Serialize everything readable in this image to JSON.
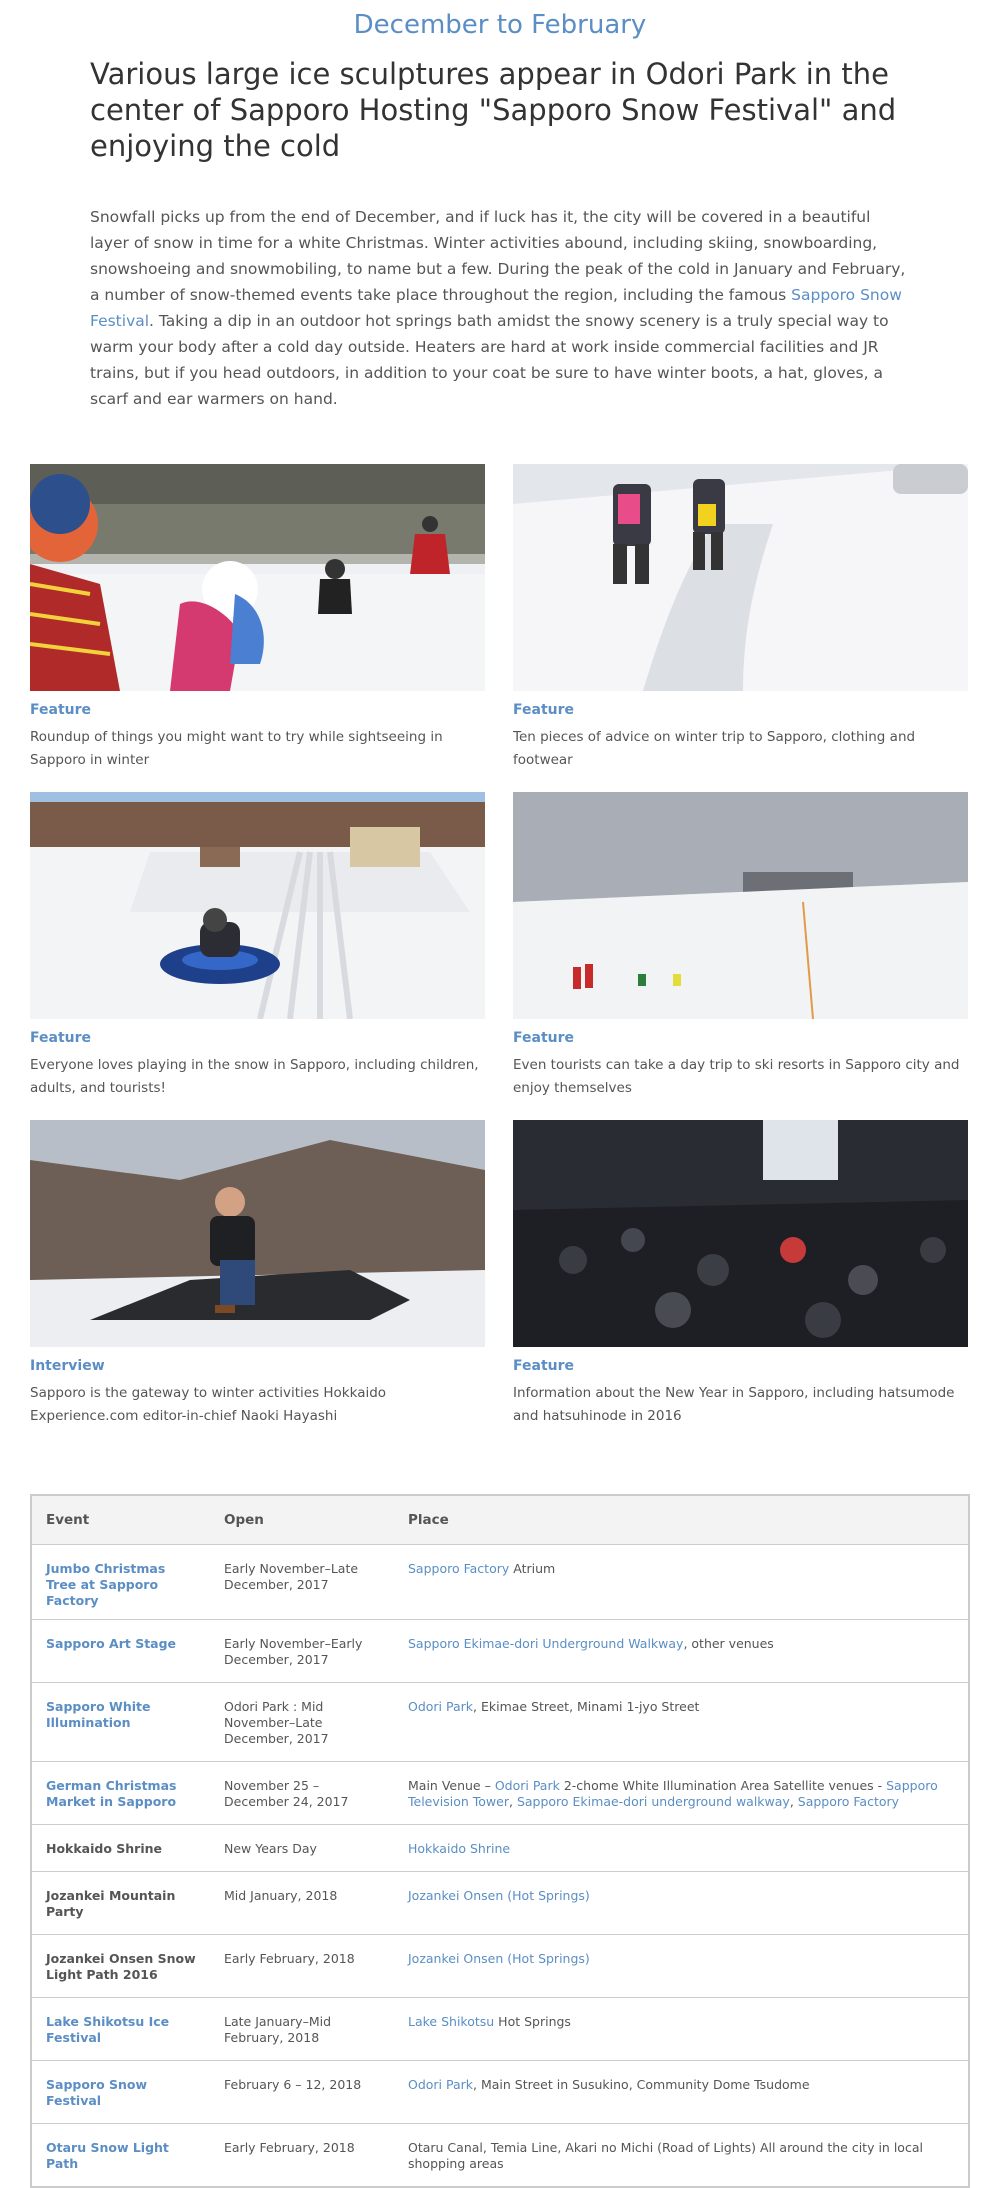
{
  "season": {
    "period": "December to February",
    "headline": "Various large ice sculptures appear in Odori Park in the center of Sapporo   Hosting \"Sapporo Snow Festival\" and enjoying the cold",
    "intro_before": "Snowfall picks up from the end of December, and if luck has it, the city will be covered in a beautiful layer of snow in time for a white Christmas. Winter activities abound, including skiing, snowboarding, snowshoeing and snowmobiling, to name but a few. During the peak of the cold in January and February, a number of snow-themed events take place throughout the region, including the famous ",
    "intro_link": "Sapporo Snow Festival",
    "intro_after": ". Taking a dip in an outdoor hot springs bath amidst the snowy scenery is a truly special way to warm your body after a cold day outside. Heaters are hard at work inside commercial facilities and JR trains, but if you head outdoors, in addition to your coat be sure to have winter boots, a hat, gloves, a scarf and ear warmers on hand."
  },
  "cards": [
    {
      "category": "Feature",
      "desc": "Roundup of things you might want to try while sightseeing in Sapporo in winter"
    },
    {
      "category": "Feature",
      "desc": "Ten pieces of advice on winter trip to Sapporo, clothing and footwear"
    },
    {
      "category": "Feature",
      "desc": "Everyone loves playing in the snow in Sapporo, including children, adults, and tourists!"
    },
    {
      "category": "Feature",
      "desc": "Even tourists can take a day trip to ski resorts in Sapporo city and enjoy themselves"
    },
    {
      "category": "Interview",
      "desc": "Sapporo is the gateway to winter activities Hokkaido Experience.com editor-in-chief Naoki Hayashi"
    },
    {
      "category": "Feature",
      "desc": "Information about the New Year in Sapporo, including hatsumode and hatsuhinode in 2016"
    }
  ],
  "table": {
    "headers": [
      "Event",
      "Open",
      "Place"
    ],
    "rows": [
      {
        "event": "Jumbo Christmas Tree at Sapporo Factory",
        "open": "Early November–Late December, 2017",
        "place": [
          {
            "t": "Sapporo Factory",
            "l": true
          },
          {
            "t": " Atrium",
            "l": false
          }
        ]
      },
      {
        "event": "Sapporo Art Stage",
        "open": "Early November–Early December, 2017",
        "place": [
          {
            "t": "Sapporo Ekimae-dori Underground Walkway",
            "l": true
          },
          {
            "t": ", other venues",
            "l": false
          }
        ]
      },
      {
        "event": "Sapporo White Illumination",
        "open": "Odori Park : Mid November–Late December, 2017",
        "place": [
          {
            "t": "Odori Park",
            "l": true
          },
          {
            "t": ", Ekimae Street, Minami 1-jyo Street",
            "l": false
          }
        ]
      },
      {
        "event": "German Christmas Market in Sapporo",
        "open": "November 25 – December 24, 2017",
        "place": [
          {
            "t": "Main Venue – ",
            "l": false
          },
          {
            "t": "Odori Park",
            "l": true
          },
          {
            "t": " 2-chome White Illumination Area Satellite venues - ",
            "l": false
          },
          {
            "t": "Sapporo Television Tower",
            "l": true
          },
          {
            "t": ", ",
            "l": false
          },
          {
            "t": "Sapporo Ekimae-dori underground walkway",
            "l": true
          },
          {
            "t": ", ",
            "l": false
          },
          {
            "t": "Sapporo Factory",
            "l": true
          }
        ]
      },
      {
        "event": "Hokkaido Shrine",
        "open": "New Years Day",
        "place": [
          {
            "t": "Hokkaido Shrine",
            "l": true
          }
        ]
      },
      {
        "event": "Jozankei Mountain Party",
        "open": "Mid January, 2018",
        "place": [
          {
            "t": "Jozankei Onsen (Hot Springs)",
            "l": true
          }
        ]
      },
      {
        "event": "Jozankei Onsen Snow Light Path 2016",
        "open": "Early February, 2018",
        "place": [
          {
            "t": "Jozankei Onsen (Hot Springs)",
            "l": true
          }
        ]
      },
      {
        "event": "Lake Shikotsu Ice Festival",
        "open": "Late January–Mid February, 2018",
        "place": [
          {
            "t": "Lake Shikotsu",
            "l": true
          },
          {
            "t": " Hot Springs",
            "l": false
          }
        ]
      },
      {
        "event": "Sapporo Snow Festival",
        "open": "February 6 – 12, 2018",
        "place": [
          {
            "t": "Odori Park",
            "l": true
          },
          {
            "t": ", Main Street in Susukino, Community Dome Tsudome",
            "l": false
          }
        ]
      },
      {
        "event": "Otaru Snow Light Path",
        "open": "Early February, 2018",
        "place": [
          {
            "t": "Otaru Canal, Temia Line, Akari no Michi (Road of Lights) All around the city in local shopping areas",
            "l": false
          }
        ]
      }
    ]
  }
}
